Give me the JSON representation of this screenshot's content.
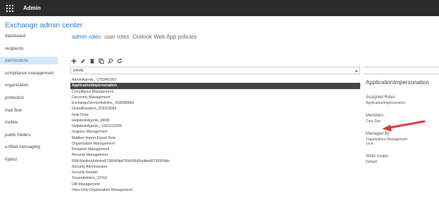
{
  "topbar": {
    "app_title": "Admin"
  },
  "page": {
    "title": "Exchange admin center"
  },
  "nav": {
    "items": [
      {
        "label": "dashboard",
        "selected": false
      },
      {
        "label": "recipients",
        "selected": false
      },
      {
        "label": "permissions",
        "selected": true
      },
      {
        "label": "compliance management",
        "selected": false
      },
      {
        "label": "organization",
        "selected": false
      },
      {
        "label": "protection",
        "selected": false
      },
      {
        "label": "mail flow",
        "selected": false
      },
      {
        "label": "mobile",
        "selected": false
      },
      {
        "label": "public folders",
        "selected": false
      },
      {
        "label": "unified messaging",
        "selected": false
      },
      {
        "label": "hybrid",
        "selected": false
      }
    ]
  },
  "tabs": [
    {
      "label": "admin roles",
      "active": true
    },
    {
      "label": "user roles",
      "active": false
    },
    {
      "label": "Outlook Web App policies",
      "active": false
    }
  ],
  "toolbar": {
    "icons": [
      "add-icon",
      "edit-icon",
      "delete-icon",
      "copy-icon",
      "search-icon",
      "refresh-icon"
    ]
  },
  "grid": {
    "column_name": "NAME",
    "rows": [
      {
        "name": "AdminAgents_-1753461007",
        "selected": false
      },
      {
        "name": "ApplicationImpersonation",
        "selected": true
      },
      {
        "name": "Compliance Management",
        "selected": false
      },
      {
        "name": "Discovery Management",
        "selected": false
      },
      {
        "name": "ExchangeServiceAdmins_-618396696",
        "selected": false
      },
      {
        "name": "GlobalReaders_318223099",
        "selected": false
      },
      {
        "name": "Help Desk",
        "selected": false
      },
      {
        "name": "HelpdeskAgents_d46fb",
        "selected": false
      },
      {
        "name": "HelpdeskAgents_-1562310306",
        "selected": false
      },
      {
        "name": "Hygiene Management",
        "selected": false
      },
      {
        "name": "Mailbox Import Export Role",
        "selected": false
      },
      {
        "name": "Organization Management",
        "selected": false
      },
      {
        "name": "Recipient Management",
        "selected": false
      },
      {
        "name": "Records Management",
        "selected": false
      },
      {
        "name": "RIM-MailboxAdmins0738949bd799409583a4bb48739309bb",
        "selected": false
      },
      {
        "name": "Security Administrator",
        "selected": false
      },
      {
        "name": "Security Reader",
        "selected": false
      },
      {
        "name": "TenantAdmins_137k3",
        "selected": false
      },
      {
        "name": "UM Management",
        "selected": false
      },
      {
        "name": "View-Only Organization Management",
        "selected": false
      }
    ]
  },
  "details": {
    "title": "ApplicationImpersonation",
    "assigned_roles_label": "Assigned Roles",
    "assigned_roles_value": "ApplicationImpersonation",
    "members_label": "Members",
    "members_value": "Cary Sun",
    "managed_by_label": "Managed By",
    "managed_by_value_1": "Organization Management",
    "managed_by_value_2": "csun",
    "write_scope_label": "Write scope",
    "write_scope_value": "Default"
  },
  "colors": {
    "accent": "#2a78c5",
    "topbar": "#2b2b2b",
    "selected_nav_bg": "#d7e9f7",
    "selected_row_bg": "#444444",
    "annotation_arrow": "#e0393e"
  }
}
